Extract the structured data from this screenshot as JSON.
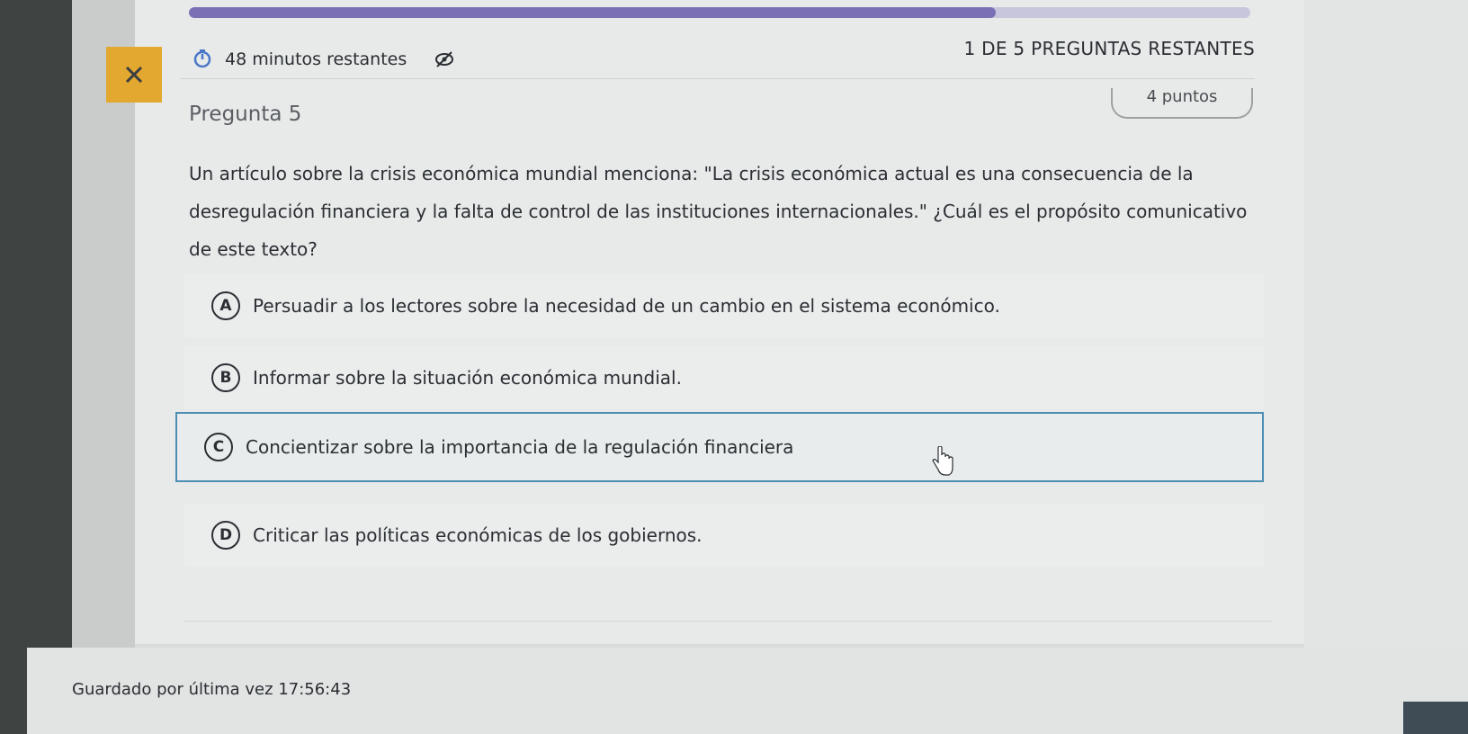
{
  "header": {
    "timer_text": "48 minutos restantes",
    "remaining_text": "1 DE 5 PREGUNTAS RESTANTES",
    "progress_fraction": 0.76
  },
  "question": {
    "title": "Pregunta 5",
    "points": "4 puntos",
    "prompt": "Un artículo sobre la crisis económica mundial menciona: \"La crisis económica actual es una consecuencia de la desregulación financiera y la falta de control de las instituciones internacionales.\" ¿Cuál es el propósito comunicativo de este texto?",
    "options": [
      {
        "letter": "A",
        "text": "Persuadir a los lectores sobre la necesidad de un cambio en el sistema económico."
      },
      {
        "letter": "B",
        "text": "Informar sobre la situación económica mundial."
      },
      {
        "letter": "C",
        "text": "Concientizar sobre la importancia de la regulación financiera"
      },
      {
        "letter": "D",
        "text": "Criticar las políticas económicas de los gobiernos."
      }
    ],
    "selected": "C"
  },
  "footer": {
    "saved_label": "Guardado por última vez",
    "saved_time": "17:56:43"
  },
  "colors": {
    "accent_progress": "#7b70b5",
    "close_tile": "#e3a830",
    "selected_border": "#4d8db3"
  },
  "icons": [
    "close-icon",
    "timer-icon",
    "hide-timer-icon",
    "hand-cursor-icon"
  ]
}
